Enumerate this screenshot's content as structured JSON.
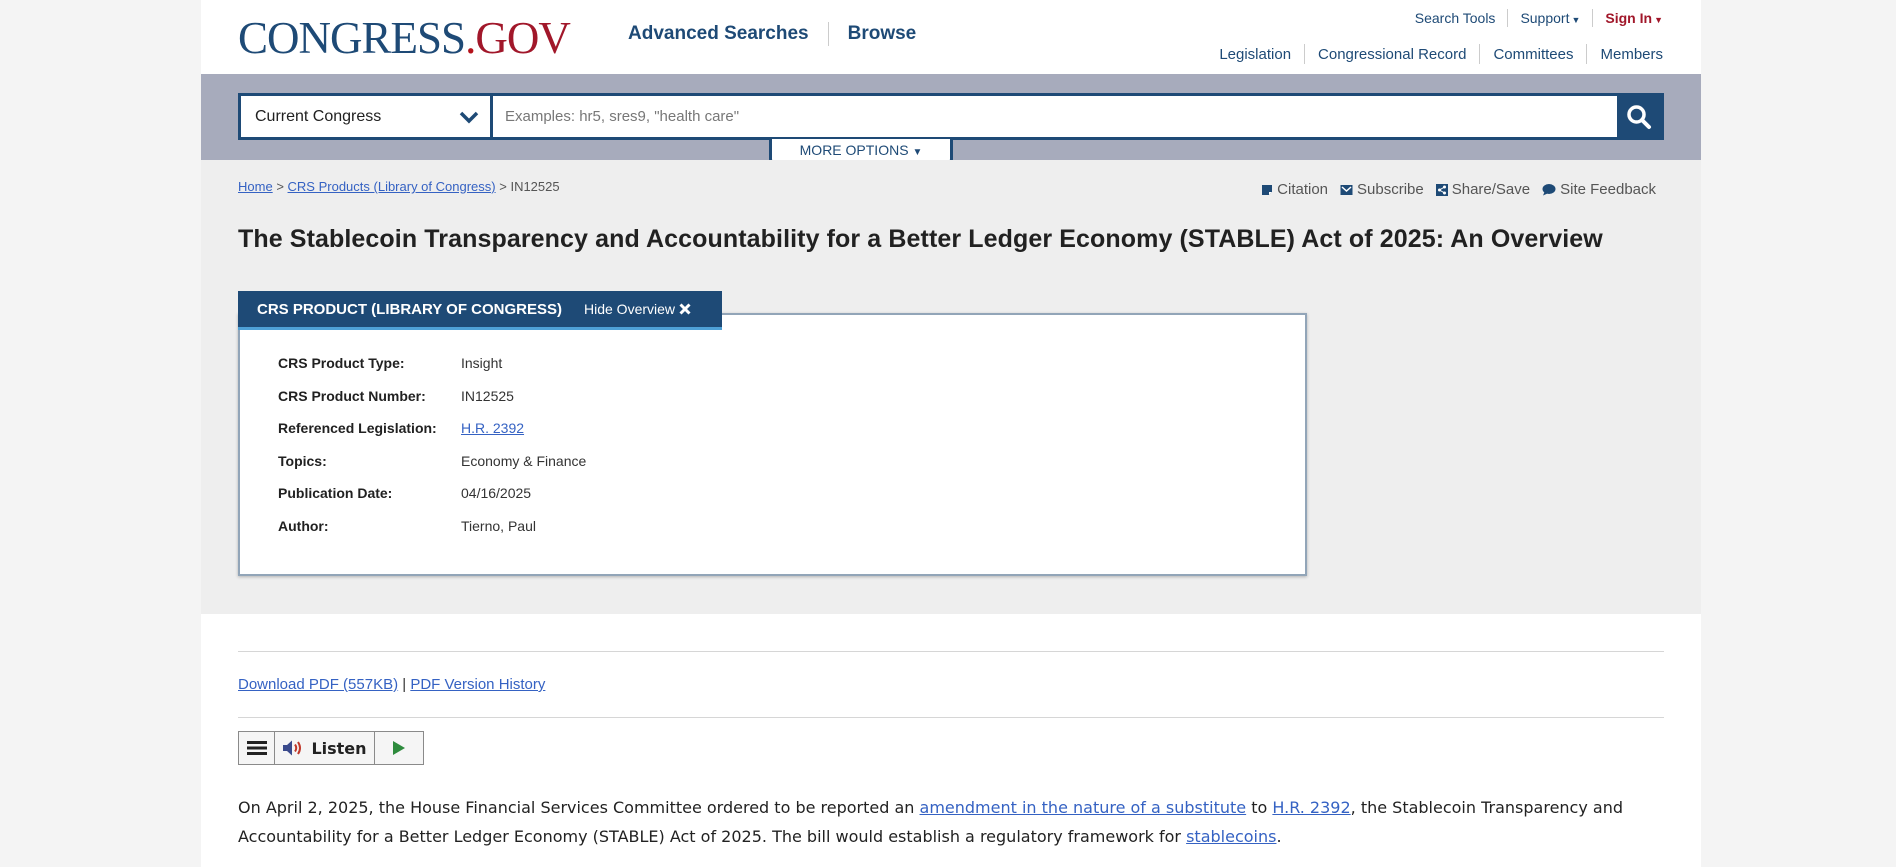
{
  "header": {
    "logo_main": "CONGRESS",
    "logo_dot": ".",
    "logo_gov": "GOV",
    "nav": [
      "Advanced Searches",
      "Browse"
    ],
    "util": {
      "search_tools": "Search Tools",
      "support": "Support",
      "sign_in": "Sign In"
    },
    "secondary": [
      "Legislation",
      "Congressional Record",
      "Committees",
      "Members"
    ]
  },
  "search": {
    "scope": "Current Congress",
    "placeholder": "Examples: hr5, sres9, \"health care\"",
    "more_options": "MORE OPTIONS"
  },
  "breadcrumb": {
    "home": "Home",
    "sep1": ">",
    "crs": "CRS Products (Library of Congress)",
    "sep2": ">",
    "current": "IN12525"
  },
  "tools": [
    "Citation",
    "Subscribe",
    "Share/Save",
    "Site Feedback"
  ],
  "title": "The Stablecoin Transparency and Accountability for a Better Ledger Economy (STABLE) Act of 2025: An Overview",
  "overview": {
    "tab_title": "CRS PRODUCT (LIBRARY OF CONGRESS)",
    "hide_label": "Hide Overview",
    "rows": [
      {
        "label": "CRS Product Type:",
        "value": "Insight"
      },
      {
        "label": "CRS Product Number:",
        "value": "IN12525"
      },
      {
        "label": "Referenced Legislation:",
        "value": "H.R. 2392"
      },
      {
        "label": "Topics:",
        "value": "Economy & Finance"
      },
      {
        "label": "Publication Date:",
        "value": "04/16/2025"
      },
      {
        "label": "Author:",
        "value": "Tierno, Paul"
      }
    ]
  },
  "downloads": {
    "pdf": "Download PDF (557KB)",
    "sep": "|",
    "history": "PDF Version History"
  },
  "listen": {
    "label": "Listen"
  },
  "body": {
    "t1": "On April 2, 2025, the House Financial Services Committee ordered to be reported an ",
    "l1": "amendment in the nature of a substitute",
    "t2": " to ",
    "l2": "H.R. 2392",
    "t3": ", the Stablecoin Transparency and Accountability for a Better Ledger Economy (STABLE) Act of 2025. The bill would establish a regulatory framework for ",
    "l3": "stablecoins",
    "t4": "."
  },
  "colors": {
    "navy": "#1e4a76",
    "red": "#a1172a",
    "link": "#3562c3",
    "band": "#a7abbc"
  }
}
